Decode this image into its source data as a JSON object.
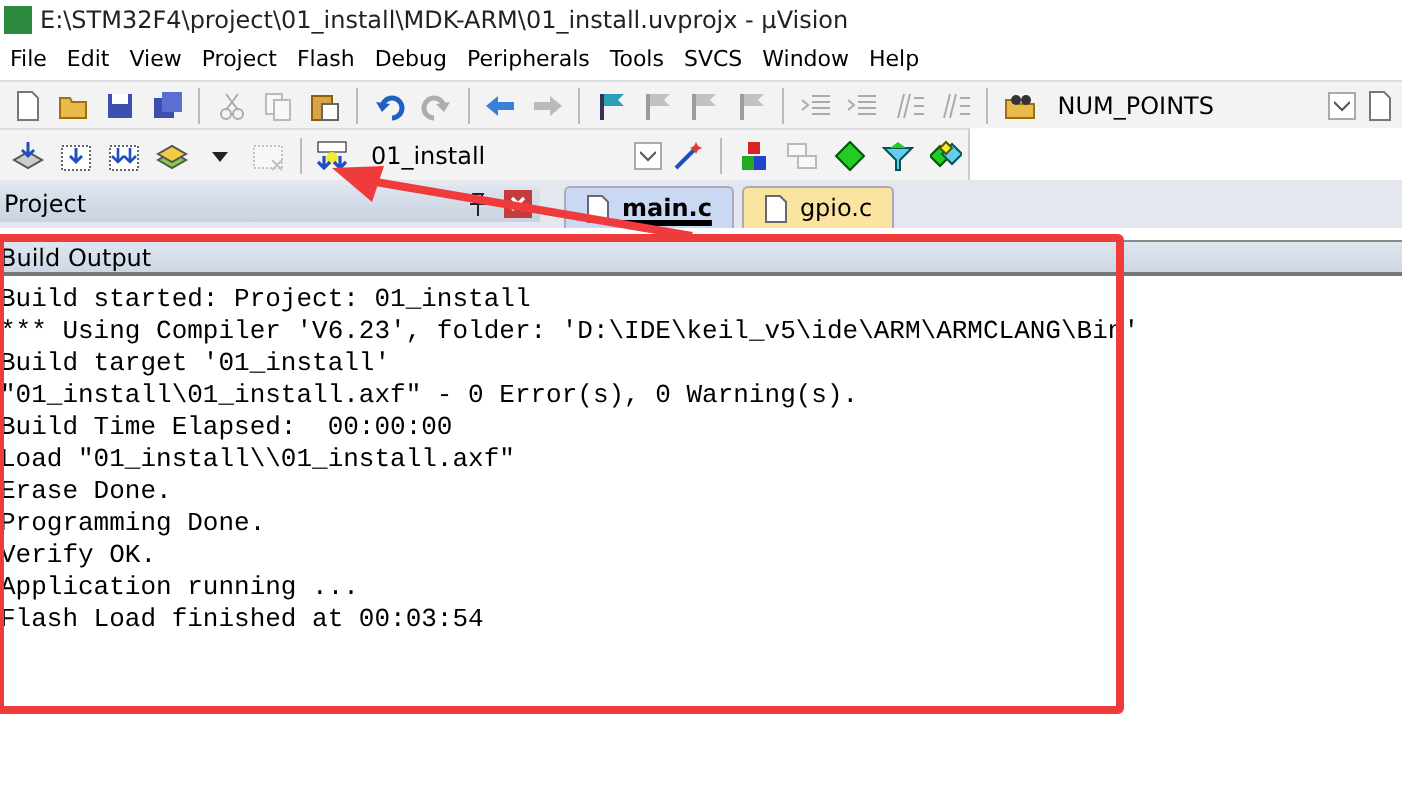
{
  "window": {
    "title": "E:\\STM32F4\\project\\01_install\\MDK-ARM\\01_install.uvprojx - µVision"
  },
  "menu": [
    "File",
    "Edit",
    "View",
    "Project",
    "Flash",
    "Debug",
    "Peripherals",
    "Tools",
    "SVCS",
    "Window",
    "Help"
  ],
  "toolbar": {
    "items": [
      {
        "kind": "new",
        "disabled": false
      },
      {
        "kind": "open",
        "disabled": false
      },
      {
        "kind": "save",
        "disabled": false
      },
      {
        "kind": "saveall",
        "disabled": false
      },
      {
        "kind": "sep"
      },
      {
        "kind": "cut",
        "disabled": true
      },
      {
        "kind": "copy",
        "disabled": true
      },
      {
        "kind": "paste",
        "disabled": false
      },
      {
        "kind": "sep"
      },
      {
        "kind": "undo",
        "disabled": false
      },
      {
        "kind": "redo",
        "disabled": true
      },
      {
        "kind": "sep"
      },
      {
        "kind": "back",
        "disabled": false
      },
      {
        "kind": "forward",
        "disabled": true
      },
      {
        "kind": "sep"
      },
      {
        "kind": "flag",
        "disabled": false
      },
      {
        "kind": "flag",
        "disabled": true
      },
      {
        "kind": "flag",
        "disabled": true
      },
      {
        "kind": "flag",
        "disabled": true
      },
      {
        "kind": "sep"
      },
      {
        "kind": "indent",
        "disabled": true
      },
      {
        "kind": "indent",
        "disabled": true
      },
      {
        "kind": "comment",
        "disabled": true
      },
      {
        "kind": "comment",
        "disabled": true
      },
      {
        "kind": "sep"
      },
      {
        "kind": "folder-find",
        "disabled": false
      }
    ],
    "find_combo": {
      "value": "NUM_POINTS"
    }
  },
  "build_toolbar": {
    "items": [
      {
        "kind": "translate",
        "disabled": false
      },
      {
        "kind": "build",
        "disabled": false
      },
      {
        "kind": "rebuild",
        "disabled": false
      },
      {
        "kind": "batch",
        "disabled": false
      },
      {
        "kind": "caret",
        "disabled": false
      },
      {
        "kind": "stop",
        "disabled": true
      },
      {
        "kind": "sep"
      },
      {
        "kind": "load",
        "disabled": false
      }
    ],
    "target": {
      "value": "01_install"
    },
    "after": [
      {
        "kind": "wand",
        "disabled": false
      },
      {
        "kind": "sep"
      },
      {
        "kind": "manage",
        "disabled": false
      },
      {
        "kind": "layers",
        "disabled": true
      },
      {
        "kind": "diamond",
        "disabled": false
      },
      {
        "kind": "funnel",
        "disabled": false
      },
      {
        "kind": "diamonds",
        "disabled": false
      }
    ]
  },
  "project_panel": {
    "title": "Project"
  },
  "tabs": [
    {
      "label": "main.c",
      "selected": true
    },
    {
      "label": "gpio.c",
      "selected": false
    }
  ],
  "build_output": {
    "title": "Build Output",
    "lines": [
      "Build started: Project: 01_install",
      "*** Using Compiler 'V6.23', folder: 'D:\\IDE\\keil_v5\\ide\\ARM\\ARMCLANG\\Bin'",
      "Build target '01_install'",
      "\"01_install\\01_install.axf\" - 0 Error(s), 0 Warning(s).",
      "Build Time Elapsed:  00:00:00",
      "Load \"01_install\\\\01_install.axf\"",
      "Erase Done.",
      "Programming Done.",
      "Verify OK.",
      "Application running ...",
      "Flash Load finished at 00:03:54"
    ]
  }
}
